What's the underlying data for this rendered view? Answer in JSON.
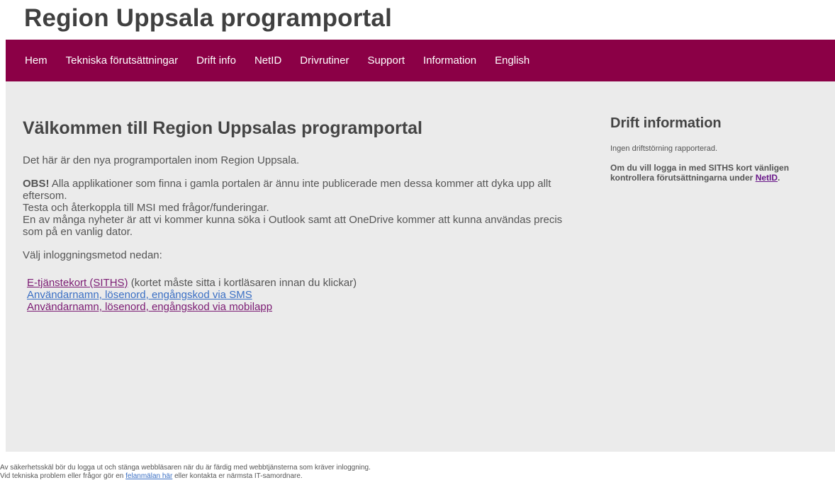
{
  "header": {
    "title": "Region Uppsala programportal"
  },
  "nav": {
    "items": [
      {
        "label": "Hem"
      },
      {
        "label": "Tekniska förutsättningar"
      },
      {
        "label": "Drift info"
      },
      {
        "label": "NetID"
      },
      {
        "label": "Drivrutiner"
      },
      {
        "label": "Support"
      },
      {
        "label": "Information"
      },
      {
        "label": "English"
      }
    ]
  },
  "main": {
    "heading": "Välkommen till Region Uppsalas programportal",
    "intro": "Det här är den nya programportalen inom Region Uppsala.",
    "obs_label": "OBS!",
    "obs_text": " Alla applikationer som finna i gamla portalen är ännu inte publicerade men dessa kommer att dyka upp allt eftersom.",
    "feedback_text": "Testa och återkoppla till MSI med frågor/funderingar.",
    "news_text": "En av många nyheter är att vi kommer kunna söka i Outlook samt att OneDrive kommer att kunna användas precis som på en vanlig dator.",
    "choose_text": "Välj inloggningsmetod nedan:",
    "login_siths_label": "E-tjänstekort (SITHS)",
    "login_siths_note": " (kortet måste sitta i kortläsaren innan du klickar)",
    "login_sms_label": "Användarnamn, lösenord, engångskod via SMS",
    "login_app_label": "Användarnamn, lösenord, engångskod via mobilapp"
  },
  "side": {
    "heading": "Drift information",
    "status": "Ingen driftstörning rapporterad.",
    "siths_text": "Om du vill logga in med SITHS kort vänligen kontrollera förutsättningarna under ",
    "siths_link": "NetID",
    "siths_end": "."
  },
  "footer": {
    "line1": "Av säkerhetsskäl bör du logga ut och stänga webbläsaren när du är färdig med webbtjänsterna som kräver inloggning.",
    "line2_start": "Vid tekniska problem eller frågor gör en ",
    "line2_link": "felanmälan här",
    "line2_end": " eller kontakta er närmsta IT-samordnare."
  },
  "colors": {
    "nav_background": "#8b0046",
    "content_background": "#ebebeb",
    "link_purple": "#7b1b73",
    "link_blue": "#3a6fc4"
  }
}
